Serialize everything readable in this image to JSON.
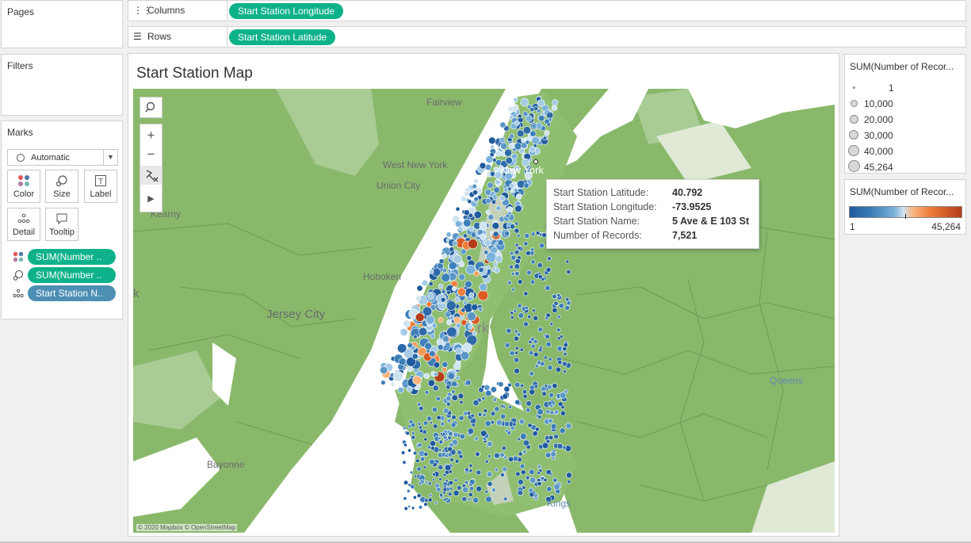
{
  "left_panel": {
    "pages_title": "Pages",
    "filters_title": "Filters",
    "marks": {
      "title": "Marks",
      "mark_type": "Automatic",
      "buttons": [
        {
          "label": "Color",
          "icon": "color-dots-icon"
        },
        {
          "label": "Size",
          "icon": "size-icon"
        },
        {
          "label": "Label",
          "icon": "label-icon"
        },
        {
          "label": "Detail",
          "icon": "detail-dots-icon"
        },
        {
          "label": "Tooltip",
          "icon": "tooltip-icon"
        }
      ],
      "fields": [
        {
          "label": "SUM(Number ..",
          "icon": "color-dots-icon",
          "color": "#0eb28a"
        },
        {
          "label": "SUM(Number ..",
          "icon": "size-icon",
          "color": "#0eb28a"
        },
        {
          "label": "Start Station N..",
          "icon": "detail-dots-icon",
          "color": "#4d8fb4"
        }
      ]
    }
  },
  "shelves": {
    "columns": {
      "label": "Columns",
      "icon": "columns-icon",
      "pill": "Start Station Longitude"
    },
    "rows": {
      "label": "Rows",
      "icon": "rows-icon",
      "pill": "Start Station Latitude"
    }
  },
  "view": {
    "title": "Start Station Map",
    "attribution": "© 2020 Mapbox © OpenStreetMap",
    "place_labels": {
      "fairview": "Fairview",
      "west_new_york": "West New York",
      "union_city": "Union City",
      "kearny": "Kearny",
      "hoboken": "Hoboken",
      "jersey_city": "Jersey City",
      "new_york": "New York",
      "rk": "rk",
      "k": "k",
      "queens": "Queens",
      "bayonne": "Bayonne",
      "kings": "Kings"
    },
    "tooltip": {
      "rows": [
        {
          "key": "Start Station Latitude:",
          "value": "40.792"
        },
        {
          "key": "Start Station Longitude:",
          "value": "-73.9525"
        },
        {
          "key": "Start Station Name:",
          "value": "5 Ave & E 103 St"
        },
        {
          "key": "Number of Records:",
          "value": "7,521"
        }
      ]
    }
  },
  "size_legend": {
    "title": "SUM(Number of Recor...",
    "items": [
      "1",
      "10,000",
      "20,000",
      "30,000",
      "40,000",
      "45,264"
    ]
  },
  "color_legend": {
    "title": "SUM(Number of Recor...",
    "min": "1",
    "max": "45,264",
    "colors": {
      "low": "#1f5a9c",
      "mid": "#cfe3f0",
      "high": "#b53d18"
    }
  },
  "colors": {
    "land": "#89b86b",
    "water": "#ffffff",
    "pill_green": "#0eb28a",
    "pill_blue": "#4d8fb4"
  }
}
